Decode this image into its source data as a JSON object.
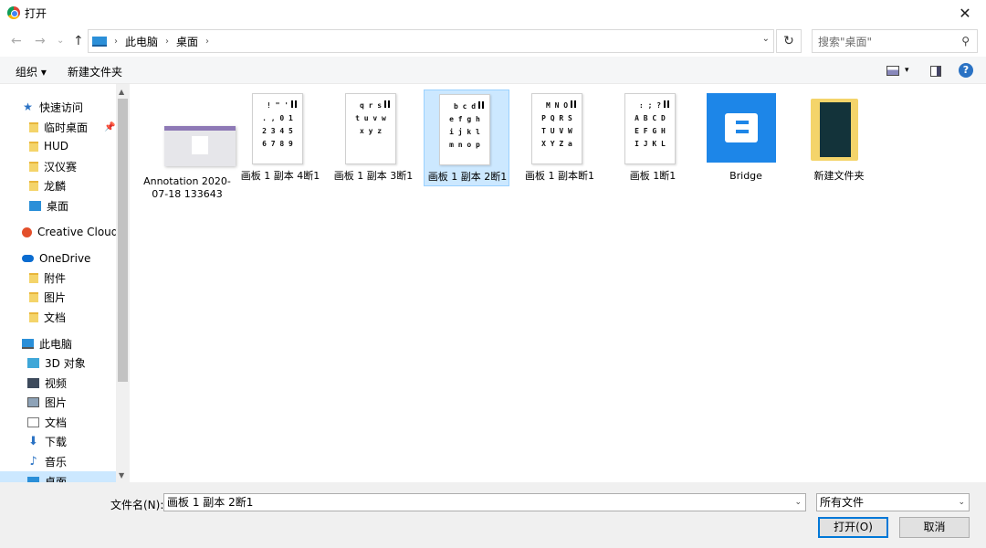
{
  "window": {
    "title": "打开",
    "close": "✕"
  },
  "nav": {
    "back": "←",
    "forward": "→",
    "history": "⌄",
    "up": "↑",
    "refresh": "↻"
  },
  "address": {
    "crumbs": [
      "此电脑",
      "桌面"
    ],
    "sep": "›"
  },
  "search": {
    "placeholder": "搜索\"桌面\"",
    "icon": "search-icon"
  },
  "toolbar": {
    "organize": "组织 ▾",
    "new_folder": "新建文件夹",
    "view_dd": "▾"
  },
  "sidebar": {
    "quick_access": "快速访问",
    "items": [
      {
        "label": "临时桌面",
        "icon": "folder-icon"
      },
      {
        "label": "HUD",
        "icon": "folder-icon"
      },
      {
        "label": "汉仪赛",
        "icon": "folder-icon"
      },
      {
        "label": "龙麟",
        "icon": "folder-icon"
      },
      {
        "label": "桌面",
        "icon": "desktop-icon"
      }
    ],
    "creative_cloud": "Creative Cloud F",
    "onedrive": "OneDrive",
    "onedrive_items": [
      "附件",
      "图片",
      "文档"
    ],
    "this_pc": "此电脑",
    "pc_items": [
      "3D 对象",
      "视频",
      "图片",
      "文档",
      "下载",
      "音乐",
      "桌面"
    ]
  },
  "files": [
    {
      "label": "Annotation 2020-07-18 133643",
      "type": "screenshot"
    },
    {
      "label": "画板 1 副本 4断1",
      "type": "image",
      "glyphs": [
        "! \" ' ",
        ". , 0 1",
        "2 3 4 5",
        "6 7 8 9"
      ]
    },
    {
      "label": "画板 1 副本 3断1",
      "type": "image",
      "glyphs": [
        "q r s",
        "t u v w",
        "x y z",
        ""
      ]
    },
    {
      "label": "画板 1 副本 2断1",
      "type": "image",
      "selected": true,
      "glyphs": [
        "b c d",
        "e f g h",
        "i j k l",
        "m n o p"
      ]
    },
    {
      "label": "画板 1 副本断1",
      "type": "image",
      "glyphs": [
        "M N O",
        "P Q R S",
        "T U V W",
        "X Y Z a"
      ]
    },
    {
      "label": "画板 1断1",
      "type": "image",
      "glyphs": [
        ": ; ?",
        "A B C D",
        "E F G H",
        "I J K L"
      ]
    },
    {
      "label": "Bridge",
      "type": "app"
    },
    {
      "label": "新建文件夹",
      "type": "folder"
    }
  ],
  "bottom": {
    "filename_label": "文件名(N):",
    "filename_value": "画板 1 副本 2断1",
    "filetype_value": "所有文件",
    "open_button": "打开(O)",
    "cancel_button": "取消"
  }
}
